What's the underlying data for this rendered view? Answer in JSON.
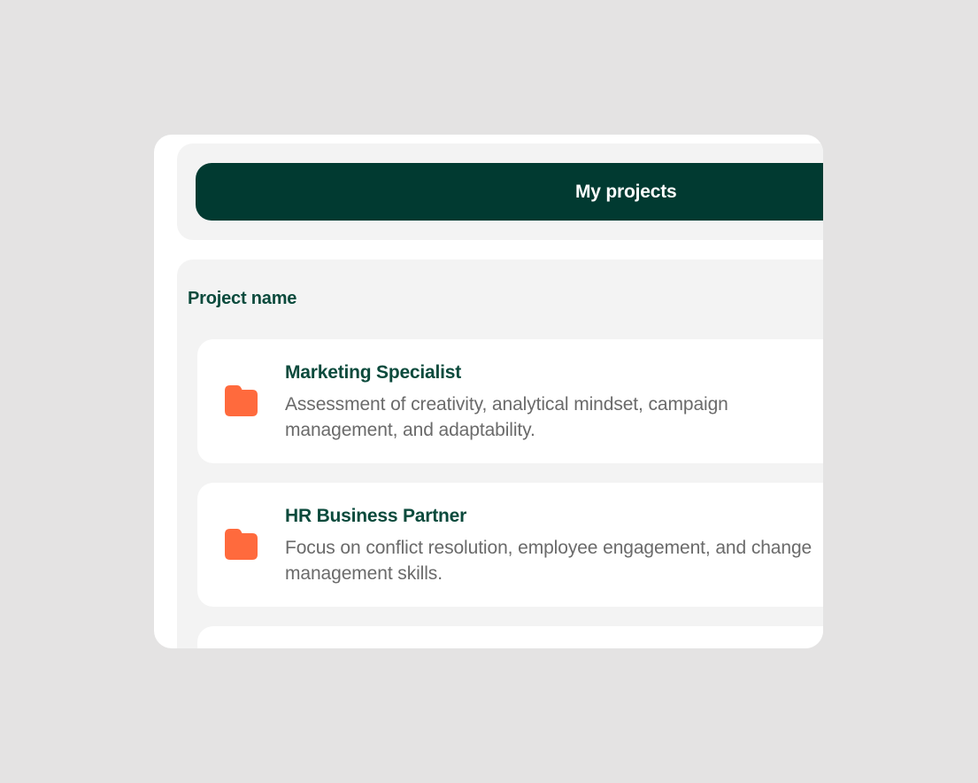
{
  "header": {
    "active_tab": "My projects"
  },
  "list": {
    "column_header": "Project name",
    "projects": [
      {
        "title": "Marketing Specialist",
        "description": "Assessment of creativity, analytical mindset, campaign management, and adaptability.",
        "icon": "folder-icon"
      },
      {
        "title": "HR Business Partner",
        "description": "Focus on conflict resolution, employee engagement, and change management skills.",
        "icon": "folder-icon"
      }
    ]
  },
  "colors": {
    "background": "#e4e3e3",
    "panel": "#f3f3f3",
    "card": "#ffffff",
    "primary": "#013a31",
    "title_text": "#0b4a3c",
    "body_text": "#6a6a6a",
    "accent": "#ff6a3d"
  }
}
